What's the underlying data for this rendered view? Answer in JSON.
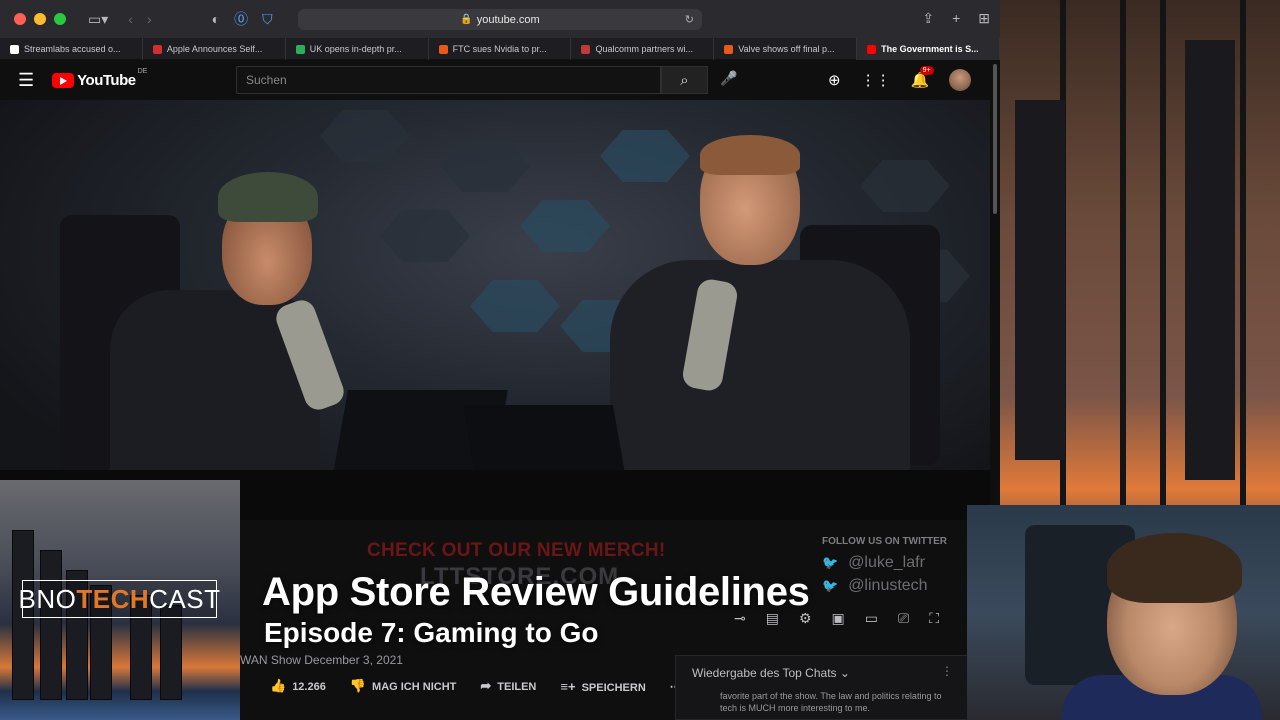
{
  "browser": {
    "url": "youtube.com",
    "tabs": [
      {
        "label": "Streamlabs accused o...",
        "color": "#ffffff"
      },
      {
        "label": "Apple Announces Self...",
        "color": "#d03030"
      },
      {
        "label": "UK opens in-depth pr...",
        "color": "#2eae5a"
      },
      {
        "label": "FTC sues Nvidia to pr...",
        "color": "#e85a1a"
      },
      {
        "label": "Qualcomm partners wi...",
        "color": "#c03a3a"
      },
      {
        "label": "Valve shows off final p...",
        "color": "#e85a1a"
      },
      {
        "label": "The Government is S...",
        "color": "#ff0000"
      }
    ]
  },
  "youtube": {
    "logo_text": "YouTube",
    "country_code": "DE",
    "search_placeholder": "Suchen",
    "notification_count": "9+"
  },
  "video": {
    "merch_line1": "CHECK OUT OUR NEW MERCH!",
    "merch_line2": "LTTSTORE.COM",
    "follow_label": "FOLLOW US ON TWITTER",
    "twitter_handles": [
      "@luke_lafr",
      "@linustech"
    ],
    "meta": "WAN Show December 3, 2021",
    "likes": "12.266",
    "dislike_label": "MAG ICH NICHT",
    "share_label": "TEILEN",
    "save_label": "SPEICHERN",
    "chat_header": "Wiedergabe des Top Chats",
    "chat_message": "favorite part of the show. The law and politics relating to tech is MUCH more interesting to me."
  },
  "overlay": {
    "title": "App Store Review Guidelines",
    "subtitle": "Episode 7: Gaming to Go",
    "brand_pre": "BNO",
    "brand_mid": "TECH",
    "brand_post": "CAST",
    "brand_accent": "#e0782a"
  }
}
